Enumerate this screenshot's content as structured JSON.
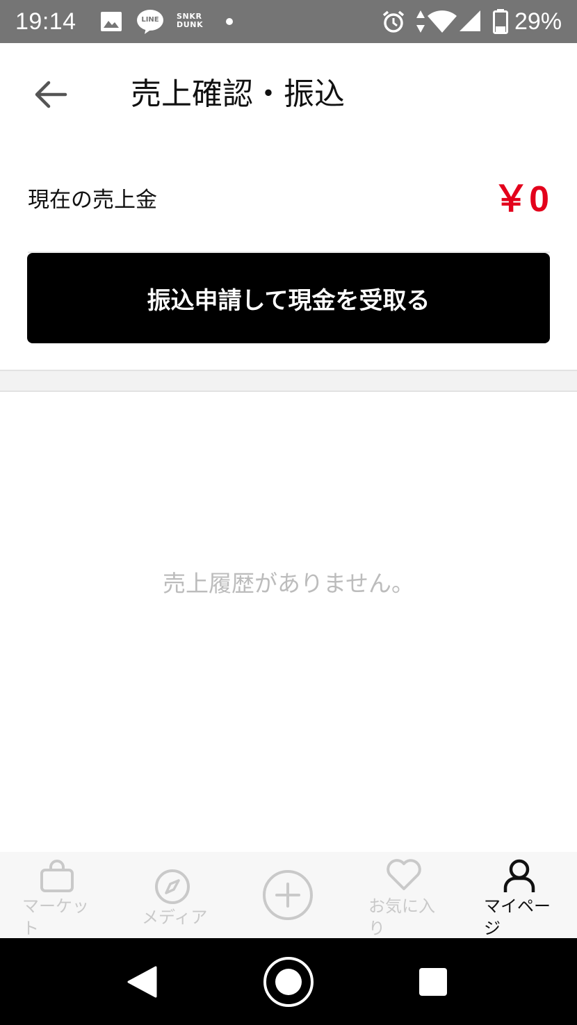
{
  "status_bar": {
    "time": "19:14",
    "battery": "29%",
    "notification_icons": [
      "image-icon",
      "line-icon",
      "snkr-dunk-icon",
      "dot-icon"
    ],
    "snkr_dunk_line1": "SNKR",
    "snkr_dunk_line2": "DUNK",
    "line_label": "LINE",
    "system_icons": [
      "alarm-icon",
      "data-arrows-icon",
      "wifi-icon",
      "signal-icon",
      "battery-icon"
    ]
  },
  "header": {
    "back_icon": "arrow-left-icon",
    "title": "売上確認・振込"
  },
  "balance": {
    "label": "現在の売上金",
    "value": "￥0",
    "value_color": "#e3001b"
  },
  "transfer_button": {
    "label": "振込申請して現金を受取る"
  },
  "history": {
    "empty_message": "売上履歴がありません。"
  },
  "bottom_nav": {
    "items": [
      {
        "label": "マーケット",
        "icon": "shopping-bag-icon",
        "active": false
      },
      {
        "label": "メディア",
        "icon": "compass-icon",
        "active": false
      },
      {
        "label": "",
        "icon": "plus-circle-icon",
        "active": false
      },
      {
        "label": "お気に入り",
        "icon": "heart-icon",
        "active": false
      },
      {
        "label": "マイページ",
        "icon": "person-icon",
        "active": true
      }
    ]
  },
  "system_nav": {
    "icons": [
      "back-triangle-icon",
      "home-circle-icon",
      "recents-square-icon"
    ]
  }
}
